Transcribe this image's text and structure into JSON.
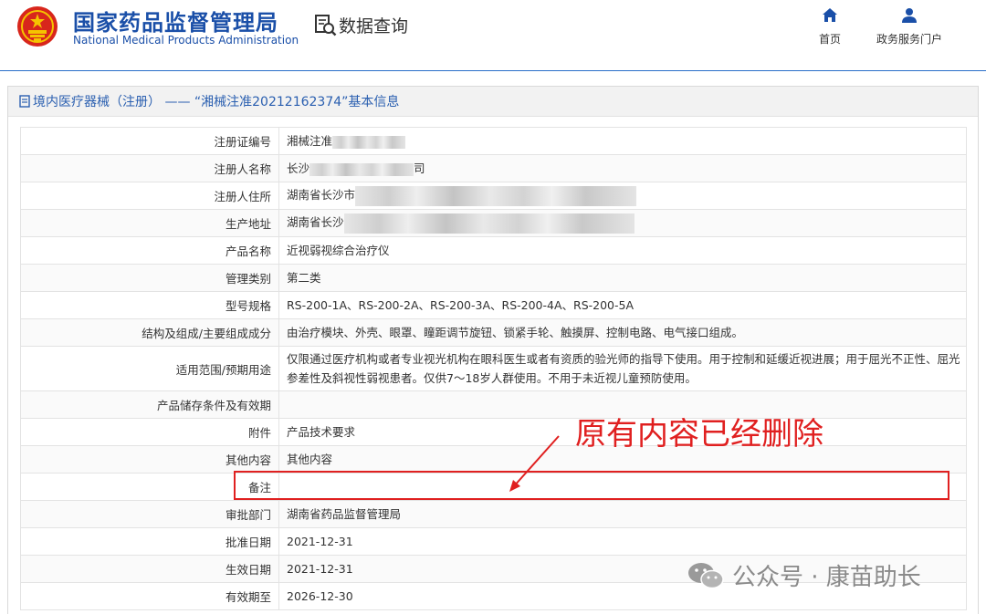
{
  "header": {
    "brand_cn": "国家药品监督管理局",
    "brand_en": "National Medical Products Administration",
    "query_label": "数据查询",
    "nav": [
      {
        "label": "首页",
        "icon": "home-icon"
      },
      {
        "label": "政务服务门户",
        "icon": "user-icon"
      }
    ],
    "accent_color": "#1a4fa8"
  },
  "panel": {
    "title": "境内医疗器械（注册） —— “湘械注准20212162374”基本信息"
  },
  "rows": [
    {
      "label": "注册证编号",
      "value": "湘械注准"
    },
    {
      "label": "注册人名称",
      "value": "长沙",
      "suffix": "司"
    },
    {
      "label": "注册人住所",
      "value": "湖南省长沙市"
    },
    {
      "label": "生产地址",
      "value": "湖南省长沙"
    },
    {
      "label": "产品名称",
      "value": "近视弱视综合治疗仪"
    },
    {
      "label": "管理类别",
      "value": "第二类"
    },
    {
      "label": "型号规格",
      "value": "RS-200-1A、RS-200-2A、RS-200-3A、RS-200-4A、RS-200-5A"
    },
    {
      "label": "结构及组成/主要组成成分",
      "value": "由治疗模块、外壳、眼罩、瞳距调节旋钮、锁紧手轮、触摸屏、控制电路、电气接口组成。"
    },
    {
      "label": "适用范围/预期用途",
      "value": "仅限通过医疗机构或者专业视光机构在眼科医生或者有资质的验光师的指导下使用。用于控制和延缓近视进展；用于屈光不正性、屈光参差性及斜视性弱视患者。仅供7～18岁人群使用。不用于未近视儿童预防使用。"
    },
    {
      "label": "产品储存条件及有效期",
      "value": ""
    },
    {
      "label": "附件",
      "value": "产品技术要求"
    },
    {
      "label": "其他内容",
      "value": "其他内容"
    },
    {
      "label": "备注",
      "value": ""
    },
    {
      "label": "审批部门",
      "value": "湖南省药品监督管理局"
    },
    {
      "label": "批准日期",
      "value": "2021-12-31"
    },
    {
      "label": "生效日期",
      "value": "2021-12-31"
    },
    {
      "label": "有效期至",
      "value": "2026-12-30"
    }
  ],
  "annotation": {
    "text": "原有内容已经删除",
    "color": "#e02020"
  },
  "watermark": {
    "text": "公众号 · 康苗助长",
    "icon": "wechat-icon"
  }
}
